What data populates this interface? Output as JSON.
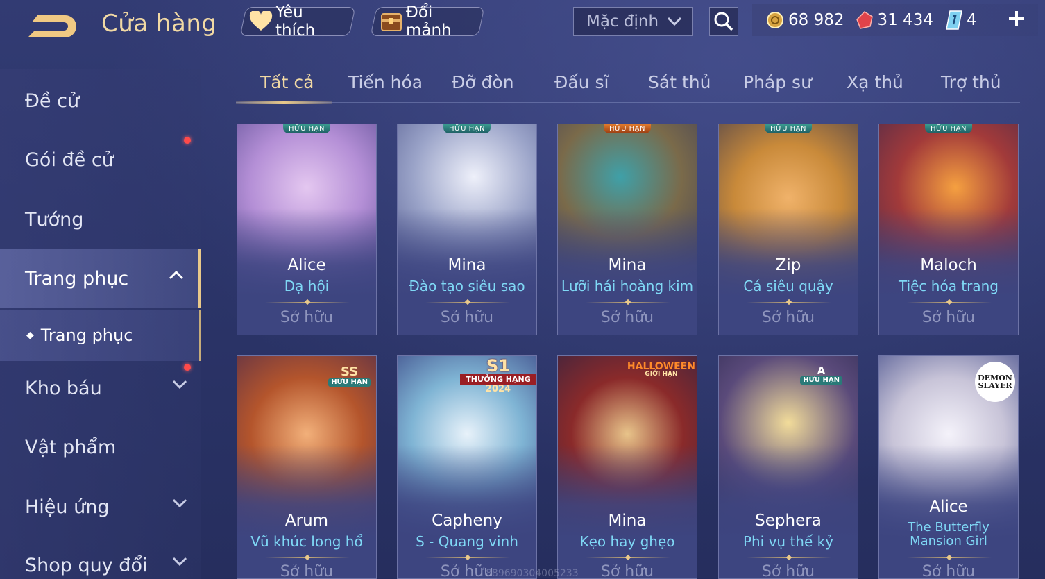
{
  "header": {
    "title": "Cửa hàng",
    "favorites_label": "Yêu thích",
    "shard_exchange_label": "Đổi mảnh",
    "sort_value": "Mặc định"
  },
  "currencies": {
    "gold": "68 982",
    "gems": "31 434",
    "vouchers": "4"
  },
  "sidebar": {
    "items": [
      {
        "label": "Đề cử"
      },
      {
        "label": "Gói đề cử"
      },
      {
        "label": "Tướng"
      },
      {
        "label": "Trang phục"
      },
      {
        "label": "Kho báu"
      },
      {
        "label": "Vật phẩm"
      },
      {
        "label": "Hiệu ứng"
      },
      {
        "label": "Shop quy đổi"
      }
    ],
    "sub_item": "Trang phục"
  },
  "tabs": [
    "Tất cả",
    "Tiến hóa",
    "Đỡ đòn",
    "Đấu sĩ",
    "Sát thủ",
    "Pháp sư",
    "Xạ thủ",
    "Trợ thủ"
  ],
  "cards": [
    {
      "hero": "Alice",
      "skin": "Dạ hội",
      "status": "Sở hữu",
      "badge": "HỮU HẠN",
      "color": "#b48fd6"
    },
    {
      "hero": "Mina",
      "skin": "Đào tạo siêu sao",
      "status": "Sở hữu",
      "badge": "HỮU HẠN",
      "color": "#9aa3c8"
    },
    {
      "hero": "Mina",
      "skin": "Lưỡi hái hoàng kim",
      "status": "Sở hữu",
      "badge": "HỮU HẠN",
      "color": "#7a6a4a"
    },
    {
      "hero": "Zip",
      "skin": "Cá siêu quậy",
      "status": "Sở hữu",
      "badge": "HỮU HẠN",
      "color": "#c98a3a"
    },
    {
      "hero": "Maloch",
      "skin": "Tiệc hóa trang",
      "status": "Sở hữu",
      "badge": "HỮU HẠN",
      "color": "#a23a3a"
    },
    {
      "hero": "Arum",
      "skin": "Vũ khúc long hổ",
      "status": "Sở hữu",
      "badge_top": "SS",
      "badge": "HỮU HẠN",
      "color": "#b4552c"
    },
    {
      "hero": "Capheny",
      "skin": "S - Quang vinh",
      "status": "Sở hữu",
      "badge_top": "S1",
      "badge": "THƯỞNG HẠNG",
      "badge_year": "2024",
      "color": "#7fb4d4"
    },
    {
      "hero": "Mina",
      "skin": "Kẹo hay ghẹo",
      "status": "Sở hữu",
      "badge_top": "HALLOWEEN",
      "badge": "GIỚI HẠN",
      "color": "#8a2a2a"
    },
    {
      "hero": "Sephera",
      "skin": "Phi vụ thế kỷ",
      "status": "Sở hữu",
      "badge_top": "A",
      "badge": "HỮU HẠN",
      "color": "#5a4a7a"
    },
    {
      "hero": "Alice",
      "skin": "The Butterfly Mansion Girl",
      "status": "Sở hữu",
      "badge_top": "DEMON",
      "badge": "SLAYER",
      "color": "#c8c4d8"
    }
  ],
  "watermark": "8896903040052​33",
  "colors": {
    "accent_gold": "#f1d9a4",
    "skin_name": "#7fd8f5",
    "notification": "#ff4a4a"
  }
}
